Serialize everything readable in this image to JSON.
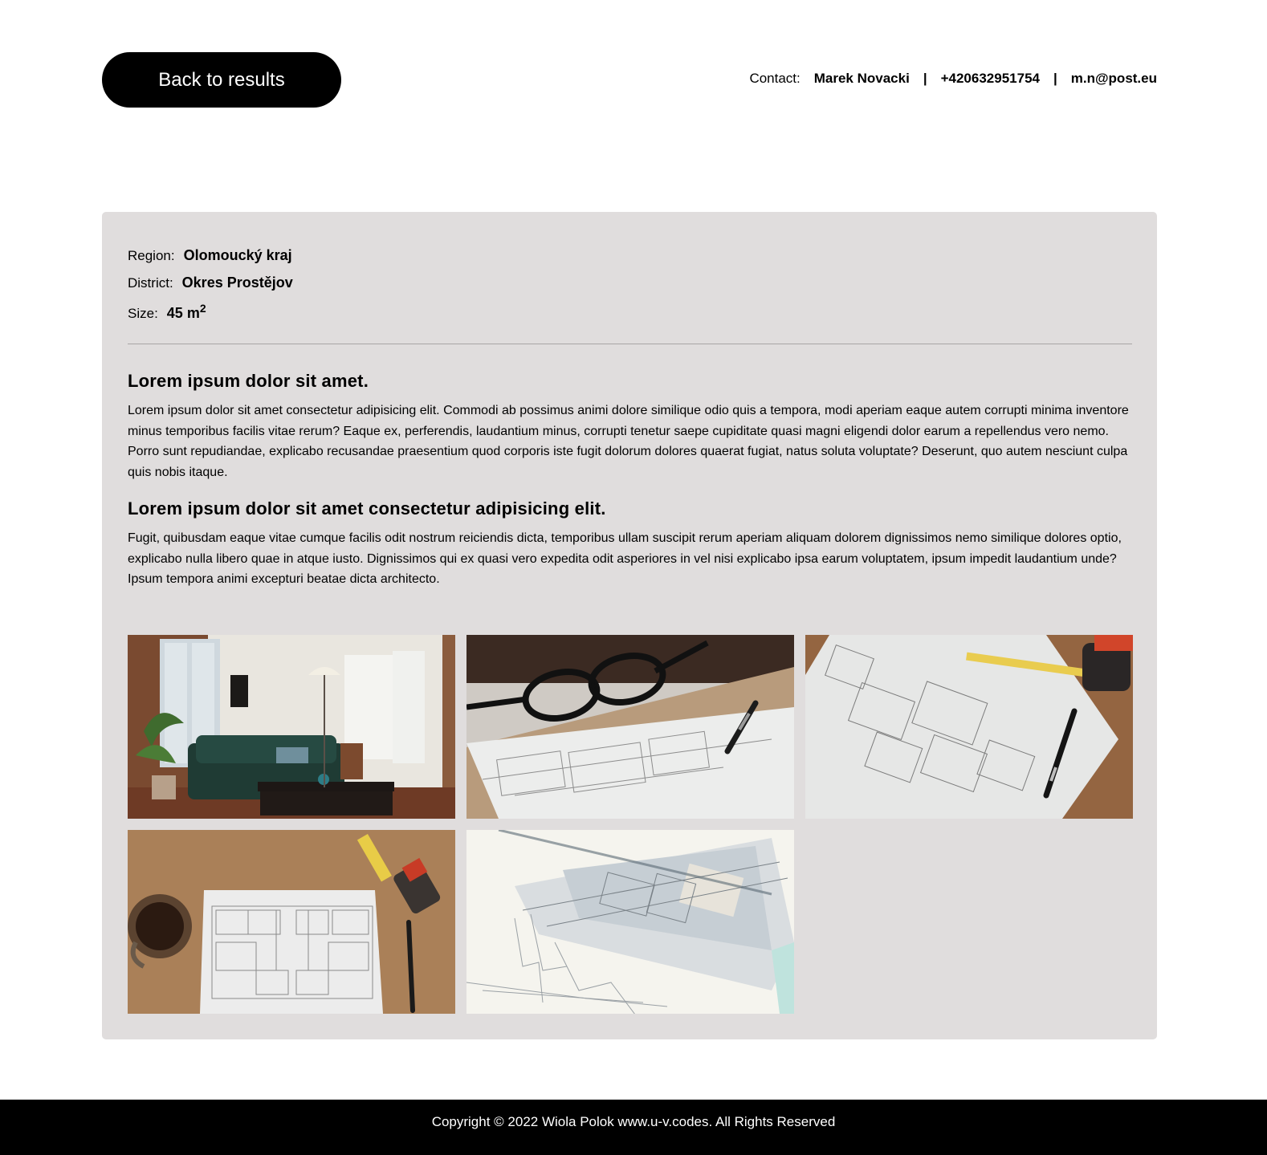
{
  "header": {
    "back_label": "Back to results",
    "contact_label": "Contact:",
    "contact_name": "Marek Novacki",
    "separator": "|",
    "contact_phone": "+420632951754",
    "contact_email": "m.n@post.eu"
  },
  "property": {
    "region_label": "Region:",
    "region_value": "Olomoucký kraj",
    "district_label": "District:",
    "district_value": "Okres Prostějov",
    "size_label": "Size:",
    "size_value": "45 m",
    "size_unit_exp": "2"
  },
  "description": {
    "heading_1": "Lorem ipsum dolor sit amet.",
    "paragraph_1": "Lorem ipsum dolor sit amet consectetur adipisicing elit. Commodi ab possimus animi dolore similique odio quis a tempora, modi aperiam eaque autem corrupti minima inventore minus temporibus facilis vitae rerum? Eaque ex, perferendis, laudantium minus, corrupti tenetur saepe cupiditate quasi magni eligendi dolor earum a repellendus vero nemo. Porro sunt repudiandae, explicabo recusandae praesentium quod corporis iste fugit dolorum dolores quaerat fugiat, natus soluta voluptate? Deserunt, quo autem nesciunt culpa quis nobis itaque.",
    "heading_2": "Lorem ipsum dolor sit amet consectetur adipisicing elit.",
    "paragraph_2": "Fugit, quibusdam eaque vitae cumque facilis odit nostrum reiciendis dicta, temporibus ullam suscipit rerum aperiam aliquam dolorem dignissimos nemo similique dolores optio, explicabo nulla libero quae in atque iusto. Dignissimos qui ex quasi vero expedita odit asperiores in vel nisi explicabo ipsa earum voluptatem, ipsum impedit laudantium unde? Ipsum tempora animi excepturi beatae dicta architecto."
  },
  "gallery": {
    "photos": [
      "living-room-photo",
      "blueprint-glasses-photo",
      "floor-plan-tape-photo",
      "floor-plan-coffee-photo",
      "architect-sketch-photo"
    ]
  },
  "footer": {
    "copyright": "Copyright © 2022 Wiola Polok www.u-v.codes. All Rights Reserved"
  }
}
